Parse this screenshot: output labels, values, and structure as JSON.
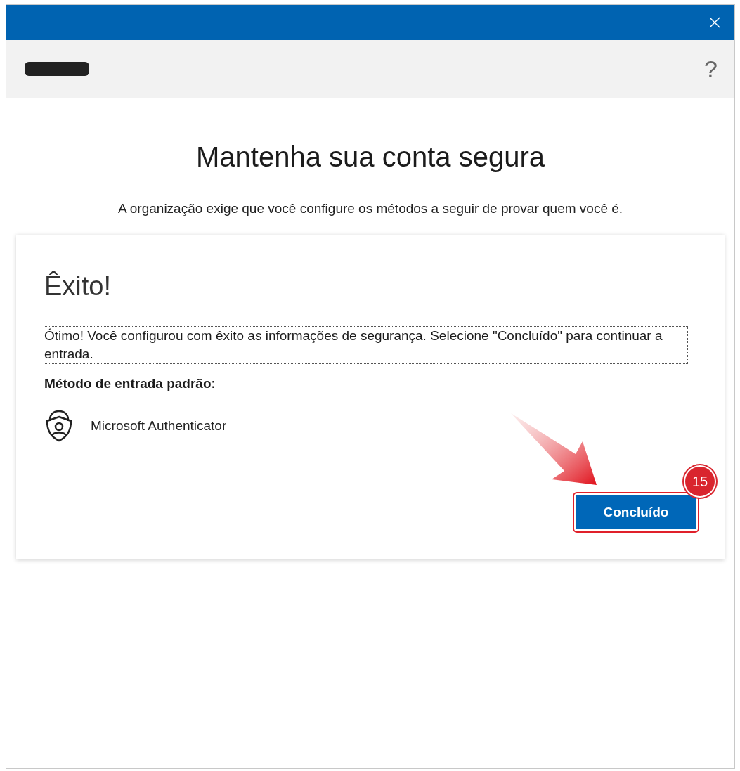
{
  "header": {
    "help": "?"
  },
  "title": "Mantenha sua conta segura",
  "subtitle": "A organização exige que você configure os métodos a seguir de provar quem você é.",
  "card": {
    "heading": "Êxito!",
    "message": "Ótimo! Você configurou com êxito as informações de segurança. Selecione \"Concluído\" para continuar a entrada.",
    "default_method_label": "Método de entrada padrão:",
    "method": "Microsoft Authenticator",
    "button": "Concluído",
    "step_badge": "15"
  }
}
